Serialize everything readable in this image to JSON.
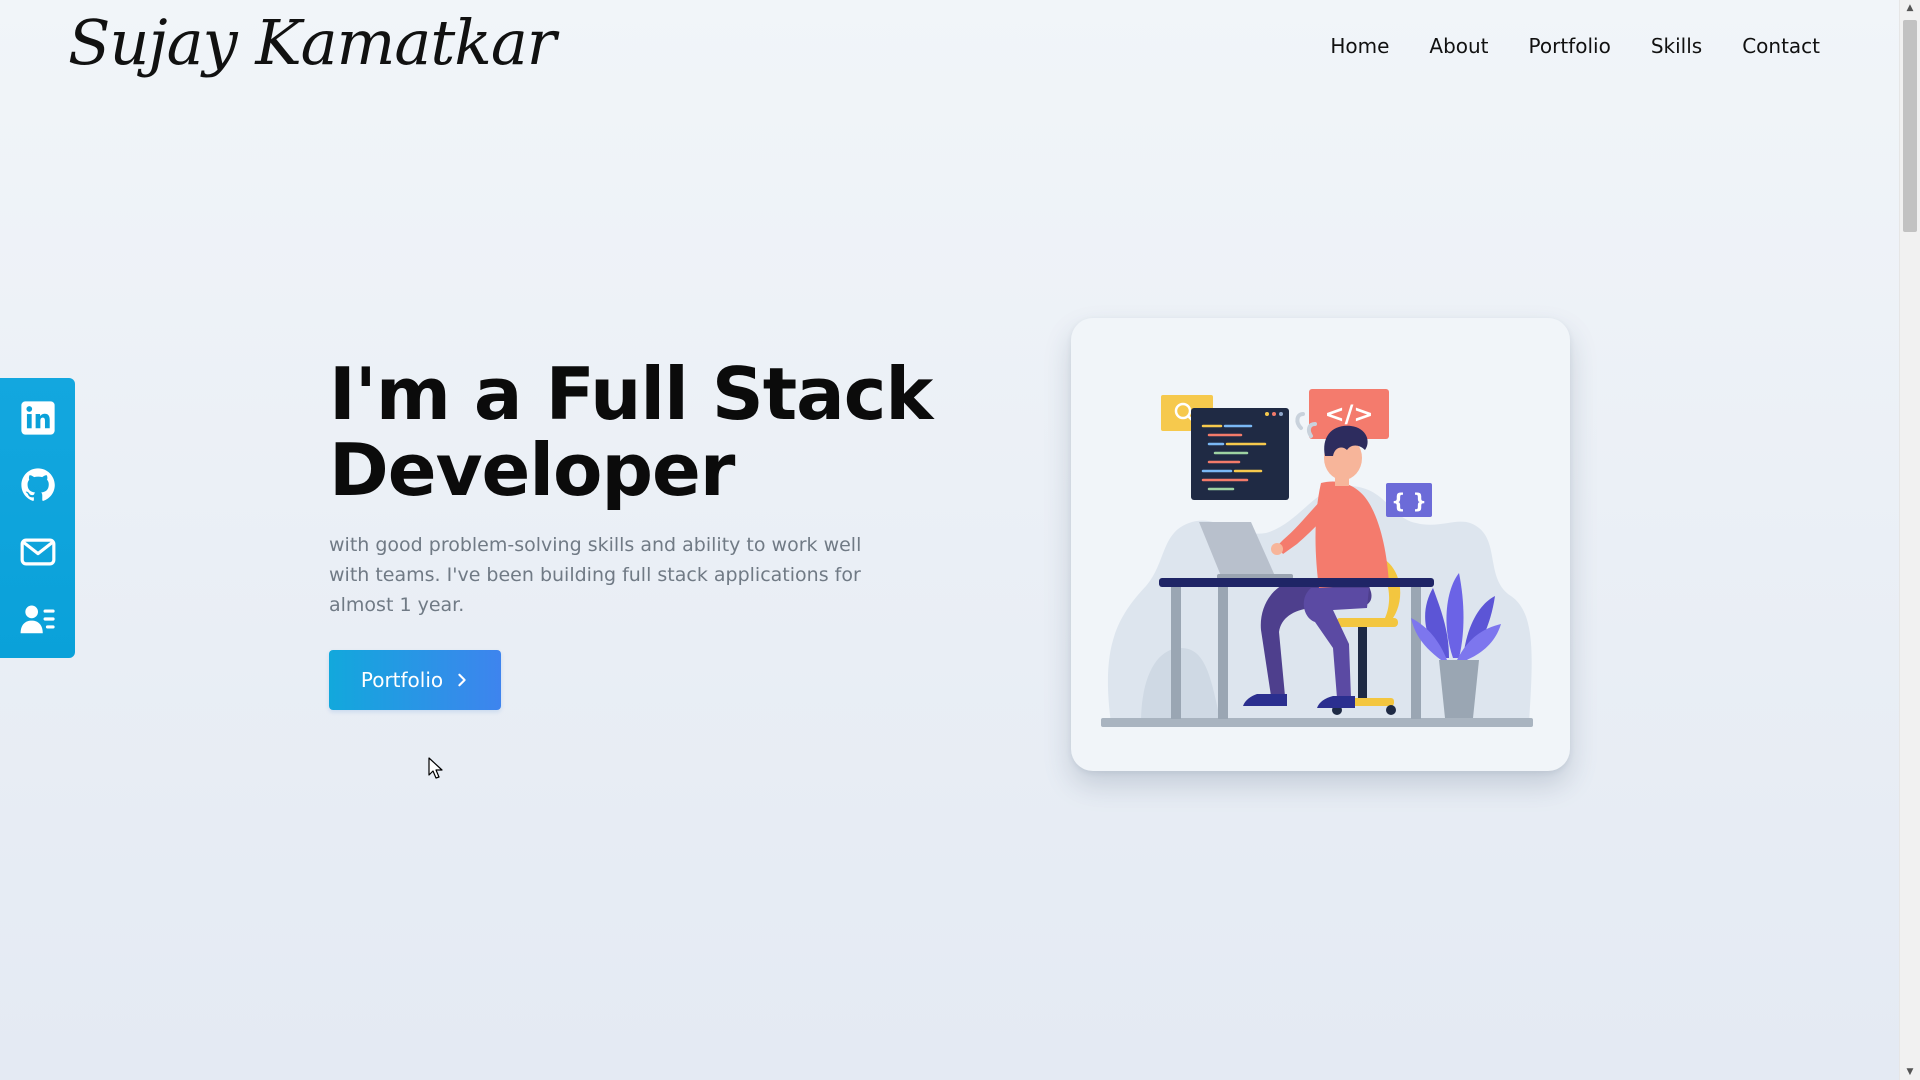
{
  "header": {
    "brand": "Sujay Kamatkar",
    "nav": [
      "Home",
      "About",
      "Portfolio",
      "Skills",
      "Contact"
    ]
  },
  "social": [
    {
      "icon": "linkedin-icon"
    },
    {
      "icon": "github-icon"
    },
    {
      "icon": "mail-icon"
    },
    {
      "icon": "contact-card-icon"
    }
  ],
  "hero": {
    "title_line1": "I'm a Full Stack",
    "title_line2": "Developer",
    "subtitle": "with good problem-solving skills and ability to work well with teams. I've been building full stack applications for almost 1 year.",
    "button_label": "Portfolio"
  },
  "illustration": {
    "code_tag": "</>",
    "braces_tag": "{ }"
  },
  "colors": {
    "accent_start": "#12a8dc",
    "accent_end": "#3e84ee",
    "sidebar": "#0aa1d9",
    "text_dark": "#0b0b0b",
    "text_muted": "#707a85"
  }
}
